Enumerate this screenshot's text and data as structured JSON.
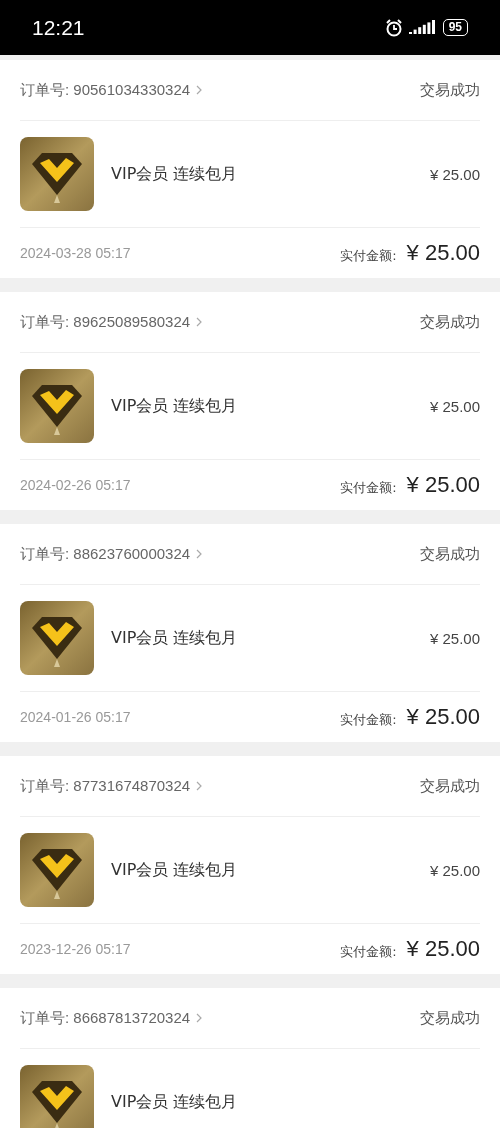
{
  "status_bar": {
    "time": "12:21",
    "battery": "95"
  },
  "orders": [
    {
      "order_label": "订单号:",
      "order_no": "90561034330324",
      "status": "交易成功",
      "product": "VIP会员 连续包月",
      "price": "¥ 25.00",
      "date": "2024-03-28 05:17",
      "paid_label": "实付金额:",
      "paid": "¥ 25.00"
    },
    {
      "order_label": "订单号:",
      "order_no": "89625089580324",
      "status": "交易成功",
      "product": "VIP会员 连续包月",
      "price": "¥ 25.00",
      "date": "2024-02-26 05:17",
      "paid_label": "实付金额:",
      "paid": "¥ 25.00"
    },
    {
      "order_label": "订单号:",
      "order_no": "88623760000324",
      "status": "交易成功",
      "product": "VIP会员 连续包月",
      "price": "¥ 25.00",
      "date": "2024-01-26 05:17",
      "paid_label": "实付金额:",
      "paid": "¥ 25.00"
    },
    {
      "order_label": "订单号:",
      "order_no": "87731674870324",
      "status": "交易成功",
      "product": "VIP会员 连续包月",
      "price": "¥ 25.00",
      "date": "2023-12-26 05:17",
      "paid_label": "实付金额:",
      "paid": "¥ 25.00"
    },
    {
      "order_label": "订单号:",
      "order_no": "86687813720324",
      "status": "交易成功",
      "product": "VIP会员 连续包月"
    }
  ]
}
